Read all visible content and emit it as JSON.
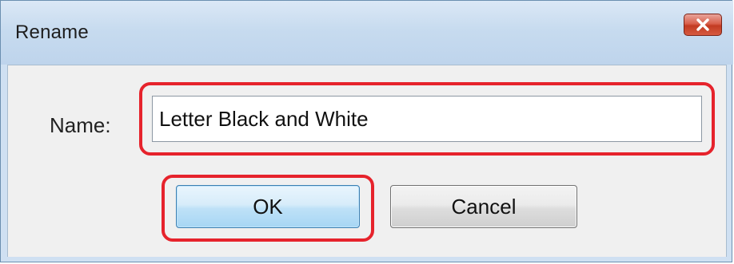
{
  "dialog": {
    "title": "Rename",
    "close_icon": "close-x-icon"
  },
  "form": {
    "name_label": "Name:",
    "name_value": "Letter Black and White"
  },
  "buttons": {
    "ok_label": "OK",
    "cancel_label": "Cancel"
  },
  "colors": {
    "highlight": "#e6232c",
    "close_button": "#c23b22",
    "ok_button_focus": "#3c7fb1"
  }
}
